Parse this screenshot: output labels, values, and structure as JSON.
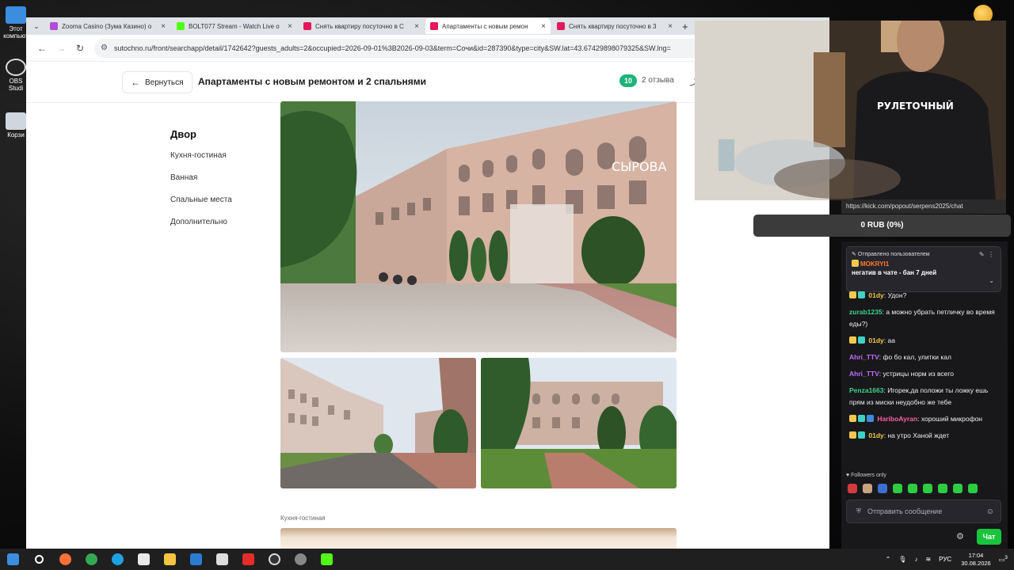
{
  "browser": {
    "tabs": [
      {
        "title": "Zooma Casino (Зума Казино) о",
        "icon": "zooma-favicon",
        "color": "#b54bd6"
      },
      {
        "title": "BOLT077 Stream - Watch Live o",
        "icon": "kick-favicon",
        "color": "#53fc18"
      },
      {
        "title": "Снять квартиру посуточно в С",
        "icon": "sutochno-favicon",
        "color": "#e3185b"
      },
      {
        "title": "Апартаменты с новым ремон",
        "icon": "sutochno-favicon",
        "color": "#e3185b",
        "active": true
      },
      {
        "title": "Снять квартиру посуточно в 3",
        "icon": "sutochno-favicon",
        "color": "#e3185b"
      }
    ],
    "url": "sutochno.ru/front/searchapp/detail/1742642?guests_adults=2&occupied=2026-09-01%3B2026-09-03&term=Сочи&id=287390&type=city&SW.lat=43.67429898079325&SW.lng="
  },
  "page": {
    "back_label": "Вернуться",
    "title": "Апартаменты с новым ремонтом и 2 спальнями",
    "rating": "10",
    "reviews": "2 отзыва",
    "nav": {
      "active": "Двор",
      "items": [
        "Кухня-гостиная",
        "Ванная",
        "Спальные места",
        "Дополнительно"
      ]
    },
    "section_label": "Кухня-гостиная",
    "photo_sign": "СЫРОВА"
  },
  "overlay": {
    "shirt_text": "РУЛЕТОЧНЫЙ",
    "chat_url": "https://kick.com/popout/serpens2025/chat",
    "donation": "0 RUB (0%)"
  },
  "chat": {
    "pinned": {
      "header": "Отправлено пользователем",
      "user": "MOKRYI1",
      "text": "негатив в чате - бан 7 дней"
    },
    "messages": [
      {
        "user": "01dy",
        "color": "#f2c94c",
        "text": "Удон?"
      },
      {
        "user": "zurab1235",
        "color": "#3fd18a",
        "text": "а можно убрать петличку во время еды?)"
      },
      {
        "user": "01dy",
        "color": "#f2c94c",
        "text": "аа"
      },
      {
        "user": "Ahri_TTV",
        "color": "#c16bff",
        "text": "фо бо кал, улитки кал"
      },
      {
        "user": "Ahri_TTV",
        "color": "#c16bff",
        "text": "устрицы норм из всего"
      },
      {
        "user": "Penza1663",
        "color": "#3fd18a",
        "text": "Игорек,да положи ты ложку ешь прям из миски неудобно же тебе"
      },
      {
        "user": "HariboAyran",
        "color": "#ff5fa2",
        "text": "хороший микрофон"
      },
      {
        "user": "01dy",
        "color": "#f2c94c",
        "text": "на утро Ханой ждет"
      }
    ],
    "followers_only": "Followers only",
    "input_placeholder": "Отправить сообщение",
    "send_label": "Чат"
  },
  "desktop": {
    "icons": [
      {
        "label": "Этот компьют",
        "icon": "computer-icon"
      },
      {
        "label": "OBS Studi",
        "icon": "obs-icon"
      },
      {
        "label": "Корзи",
        "icon": "recycle-bin-icon"
      }
    ]
  },
  "taskbar": {
    "apps": [
      "firefox",
      "chrome",
      "edge",
      "store",
      "explorer",
      "mail",
      "spark",
      "yandex",
      "obs",
      "settings",
      "kick"
    ],
    "lang": "РУС",
    "time": "17:04",
    "date": "30.08.2026",
    "notifications": "3"
  }
}
